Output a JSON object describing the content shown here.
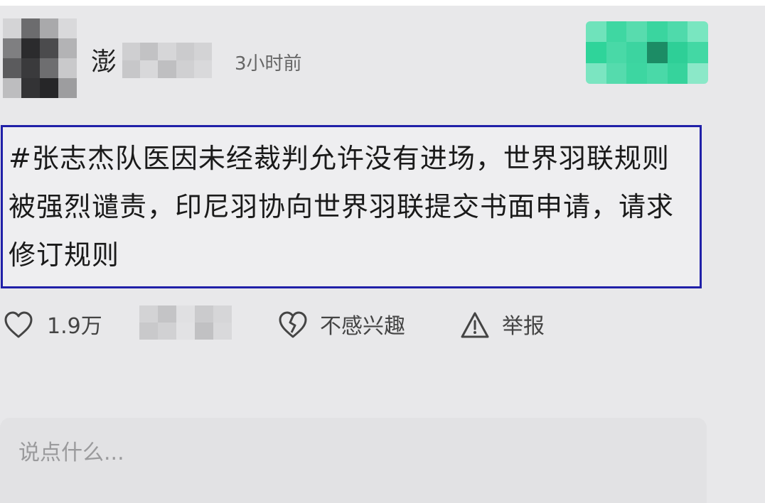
{
  "post": {
    "author_visible": "澎",
    "time": "3小时前",
    "text": "#张志杰队医因未经裁判允许没有进场，世界羽联规则被强烈谴责，印尼羽协向世界羽联提交书面申请，请求修订规则"
  },
  "actions": {
    "like_count": "1.9万",
    "dislike_label": "不感兴趣",
    "report_label": "举报"
  },
  "comment": {
    "placeholder": "说点什么..."
  },
  "icons": {
    "like": "heart-outline-icon",
    "dislike": "broken-heart-icon",
    "report": "warning-triangle-icon"
  },
  "colors": {
    "frame_border": "#2020a8",
    "follow_green": "#2fd49a"
  }
}
